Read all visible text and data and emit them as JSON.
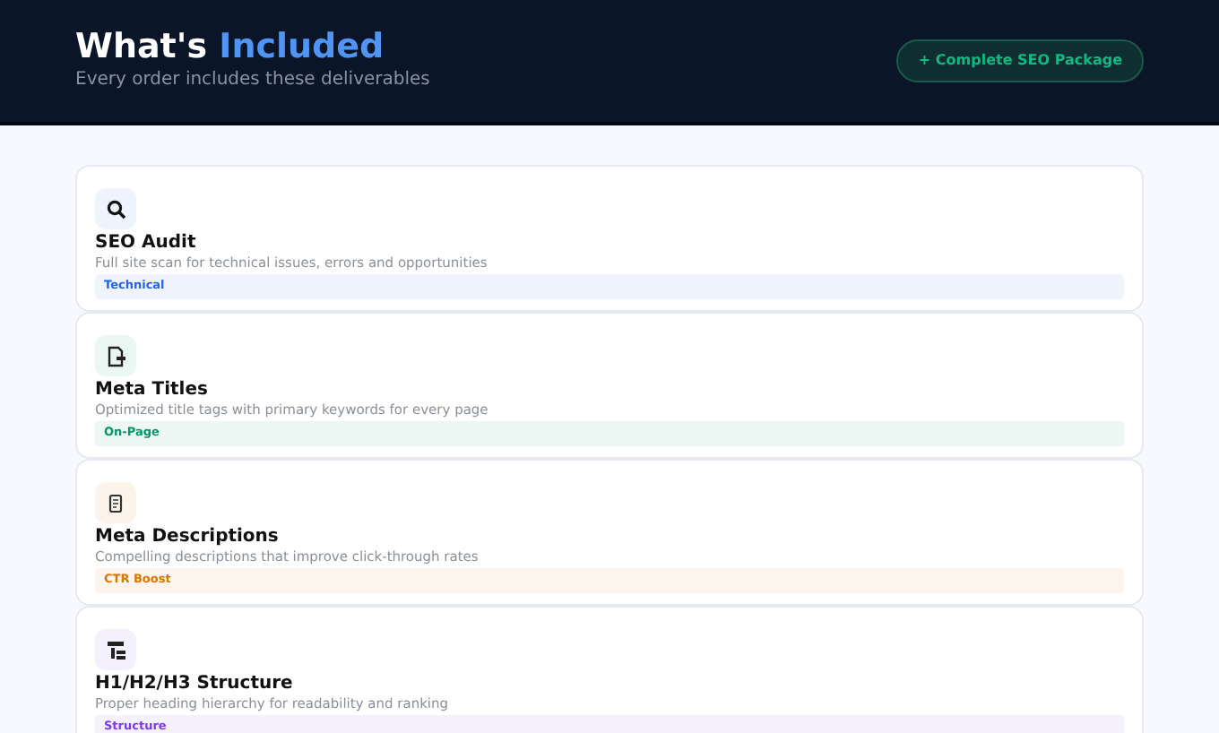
{
  "header": {
    "title": "What's",
    "title_highlight": "Included",
    "subtitle": "Every order includes these deliverables",
    "button": "+ Complete SEO Package"
  },
  "items": [
    {
      "kind": "search",
      "title": "SEO Audit",
      "description": "Full site scan for technical issues, errors and opportunities",
      "tag": "Technical",
      "color": "#2563eb"
    },
    {
      "kind": "document",
      "title": "Meta Titles",
      "description": "Optimized title tags with primary keywords for every page",
      "tag": "On-Page",
      "color": "#059669"
    },
    {
      "kind": "clipboard",
      "title": "Meta Descriptions",
      "description": "Compelling descriptions that improve click-through rates",
      "tag": "CTR Boost",
      "color": "#d97706"
    },
    {
      "kind": "hierarchy",
      "title": "H1/H2/H3 Structure",
      "description": "Proper heading hierarchy for readability and ranking",
      "tag": "Structure",
      "color": "#7c3aed"
    }
  ]
}
